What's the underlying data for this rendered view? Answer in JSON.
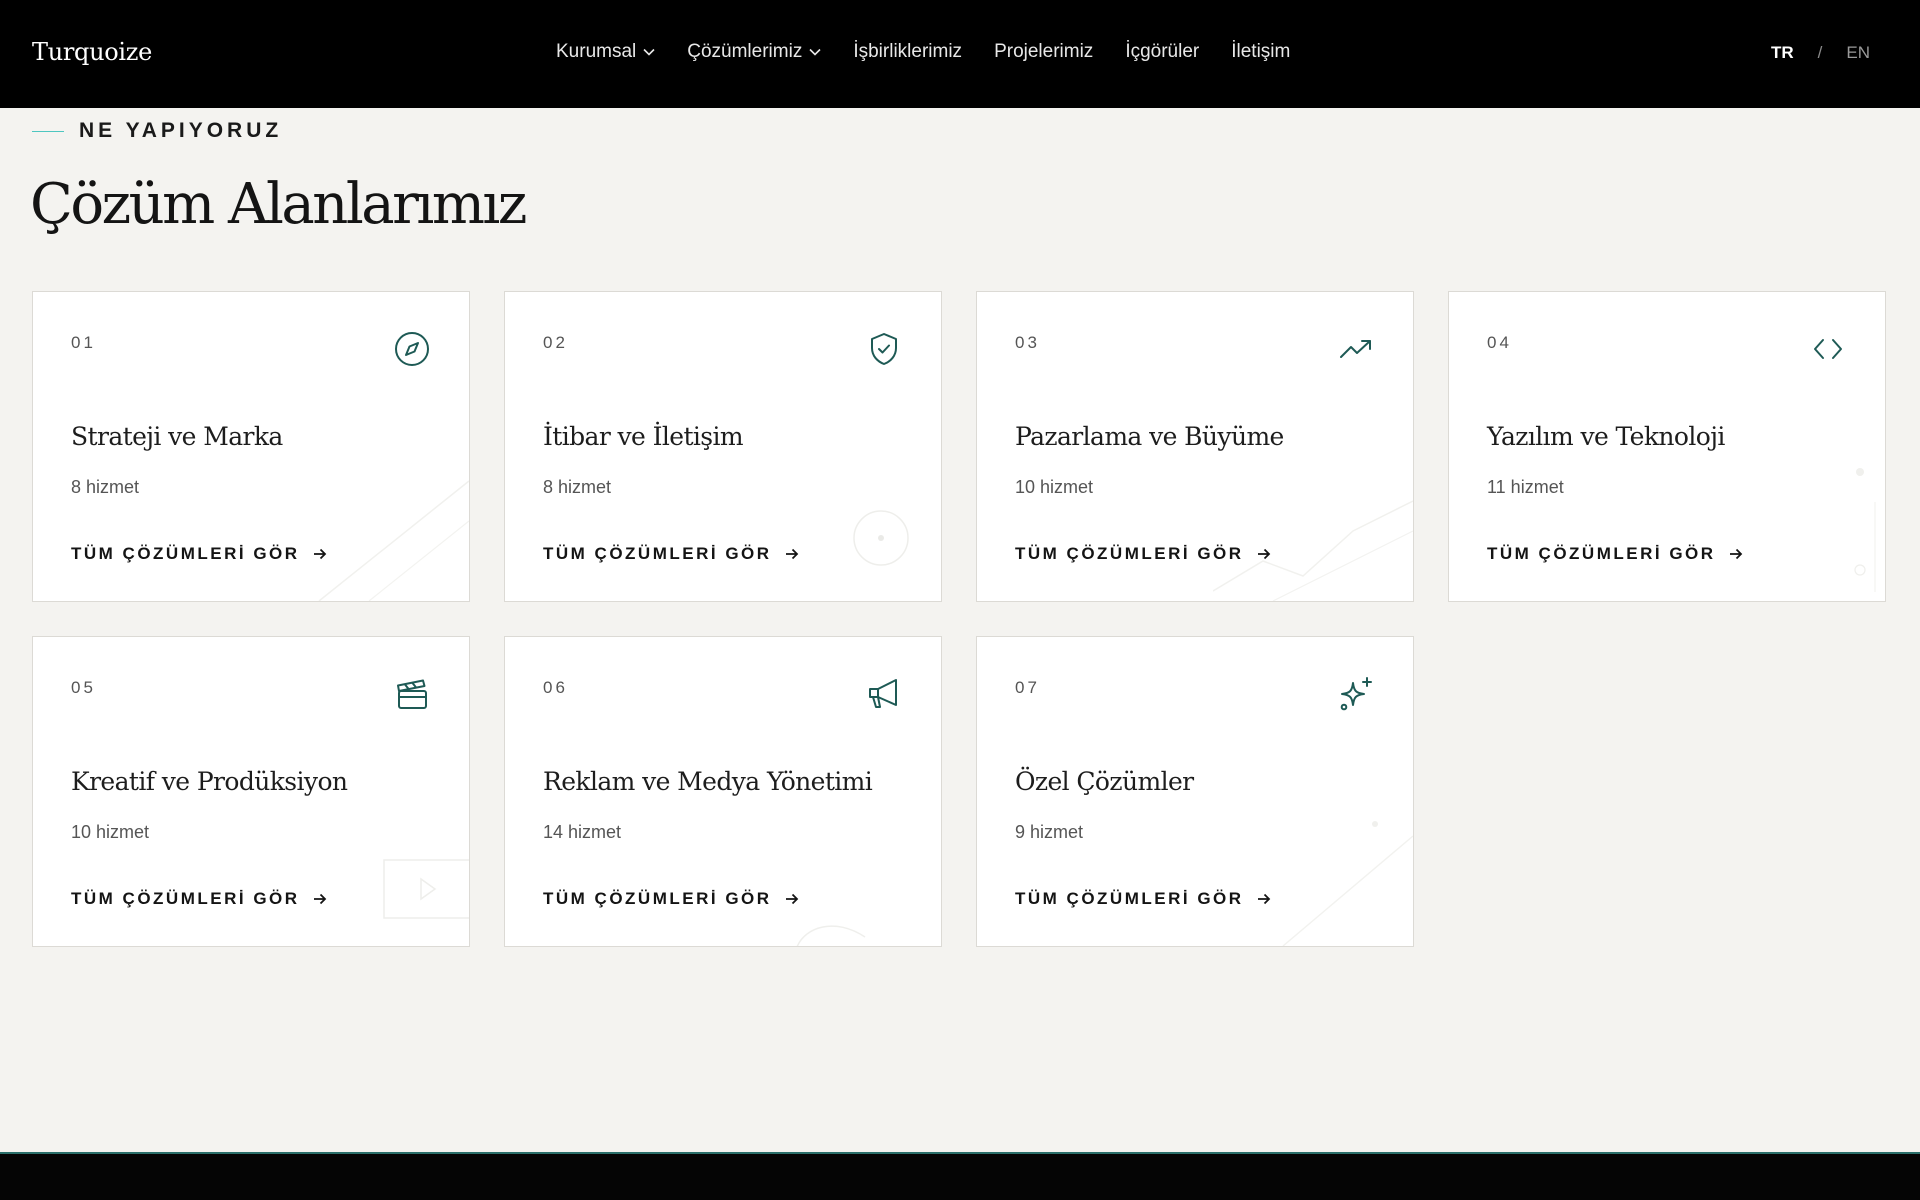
{
  "header": {
    "logo": "Turquoize",
    "nav": [
      {
        "label": "Kurumsal",
        "dropdown": true
      },
      {
        "label": "Çözümlerimiz",
        "dropdown": true
      },
      {
        "label": "İşbirliklerimiz",
        "dropdown": false
      },
      {
        "label": "Projelerimiz",
        "dropdown": false
      },
      {
        "label": "İçgörüler",
        "dropdown": false
      },
      {
        "label": "İletişim",
        "dropdown": false
      }
    ],
    "lang": {
      "active": "TR",
      "separator": "/",
      "inactive": "EN"
    }
  },
  "section": {
    "eyebrow": "NE YAPIYORUZ",
    "title": "Çözüm Alanlarımız"
  },
  "cards": [
    {
      "num": "01",
      "title": "Strateji ve Marka",
      "count": "8 hizmet",
      "link": "TÜM ÇÖZÜMLERİ GÖR",
      "icon": "compass-icon"
    },
    {
      "num": "02",
      "title": "İtibar ve İletişim",
      "count": "8 hizmet",
      "link": "TÜM ÇÖZÜMLERİ GÖR",
      "icon": "shield-check-icon"
    },
    {
      "num": "03",
      "title": "Pazarlama ve Büyüme",
      "count": "10 hizmet",
      "link": "TÜM ÇÖZÜMLERİ GÖR",
      "icon": "trending-up-icon"
    },
    {
      "num": "04",
      "title": "Yazılım ve Teknoloji",
      "count": "11 hizmet",
      "link": "TÜM ÇÖZÜMLERİ GÖR",
      "icon": "code-icon"
    },
    {
      "num": "05",
      "title": "Kreatif ve Prodüksiyon",
      "count": "10 hizmet",
      "link": "TÜM ÇÖZÜMLERİ GÖR",
      "icon": "clapperboard-icon"
    },
    {
      "num": "06",
      "title": "Reklam ve Medya Yönetimi",
      "count": "14 hizmet",
      "link": "TÜM ÇÖZÜMLERİ GÖR",
      "icon": "megaphone-icon"
    },
    {
      "num": "07",
      "title": "Özel Çözümler",
      "count": "9 hizmet",
      "link": "TÜM ÇÖZÜMLERİ GÖR",
      "icon": "sparkles-icon"
    }
  ],
  "colors": {
    "accent": "#1e5a55",
    "eyebrow_line": "#4ec6c0",
    "page_bg": "#f4f3f0",
    "header_bg": "#000000"
  }
}
